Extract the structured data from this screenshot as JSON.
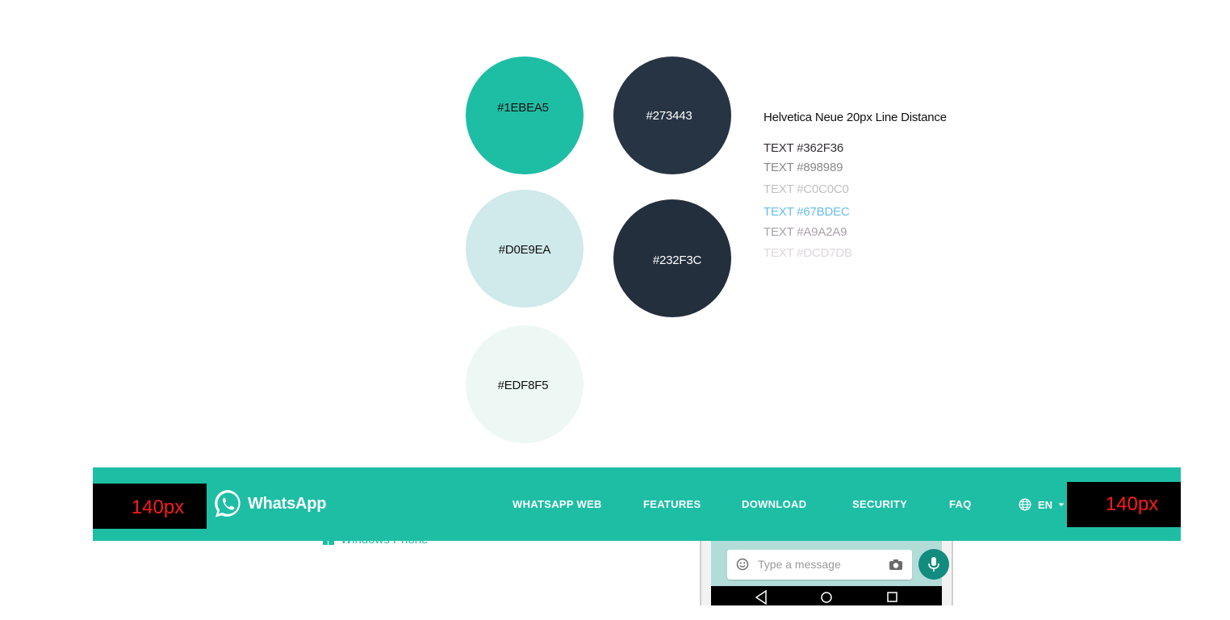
{
  "palette": {
    "swatches": [
      {
        "label": "#1EBEA5",
        "bg": "#1EBEA5",
        "text_color": "#111111"
      },
      {
        "label": "#D0E9EA",
        "bg": "#D0E9EA",
        "text_color": "#111111"
      },
      {
        "label": "#EDF8F5",
        "bg": "#EDF8F5",
        "text_color": "#111111"
      },
      {
        "label": "#273443",
        "bg": "#273443",
        "text_color": "#FFFFFF"
      },
      {
        "label": "#232F3C",
        "bg": "#232F3C",
        "text_color": "#FFFFFF"
      }
    ]
  },
  "typography": {
    "heading": "Helvetica Neue 20px Line Distance",
    "samples": [
      {
        "text": "TEXT #362F36",
        "color": "#362F36"
      },
      {
        "text": "TEXT #898989",
        "color": "#898989"
      },
      {
        "text": "TEXT #C0C0C0",
        "color": "#C0C0C0"
      },
      {
        "text": "TEXT #67BDEC",
        "color": "#67BDEC"
      },
      {
        "text": "TEXT #A9A2A9",
        "color": "#A9A2A9"
      },
      {
        "text": "TEXT #DCD7DB",
        "color": "#DCD7DB"
      }
    ]
  },
  "background_content": {
    "windows_phone_label": "Windows Phone",
    "message_placeholder": "Type a message",
    "emoji_icon": "smiley-icon",
    "camera_icon": "camera-icon",
    "mic_icon": "microphone-icon"
  },
  "nav": {
    "bg_color": "#1EBEA5",
    "brand": "WhatsApp",
    "links": [
      "WHATSAPP WEB",
      "FEATURES",
      "DOWNLOAD",
      "SECURITY",
      "FAQ"
    ],
    "language": "EN",
    "left_spacer_label": "140px",
    "right_spacer_label": "140px"
  }
}
